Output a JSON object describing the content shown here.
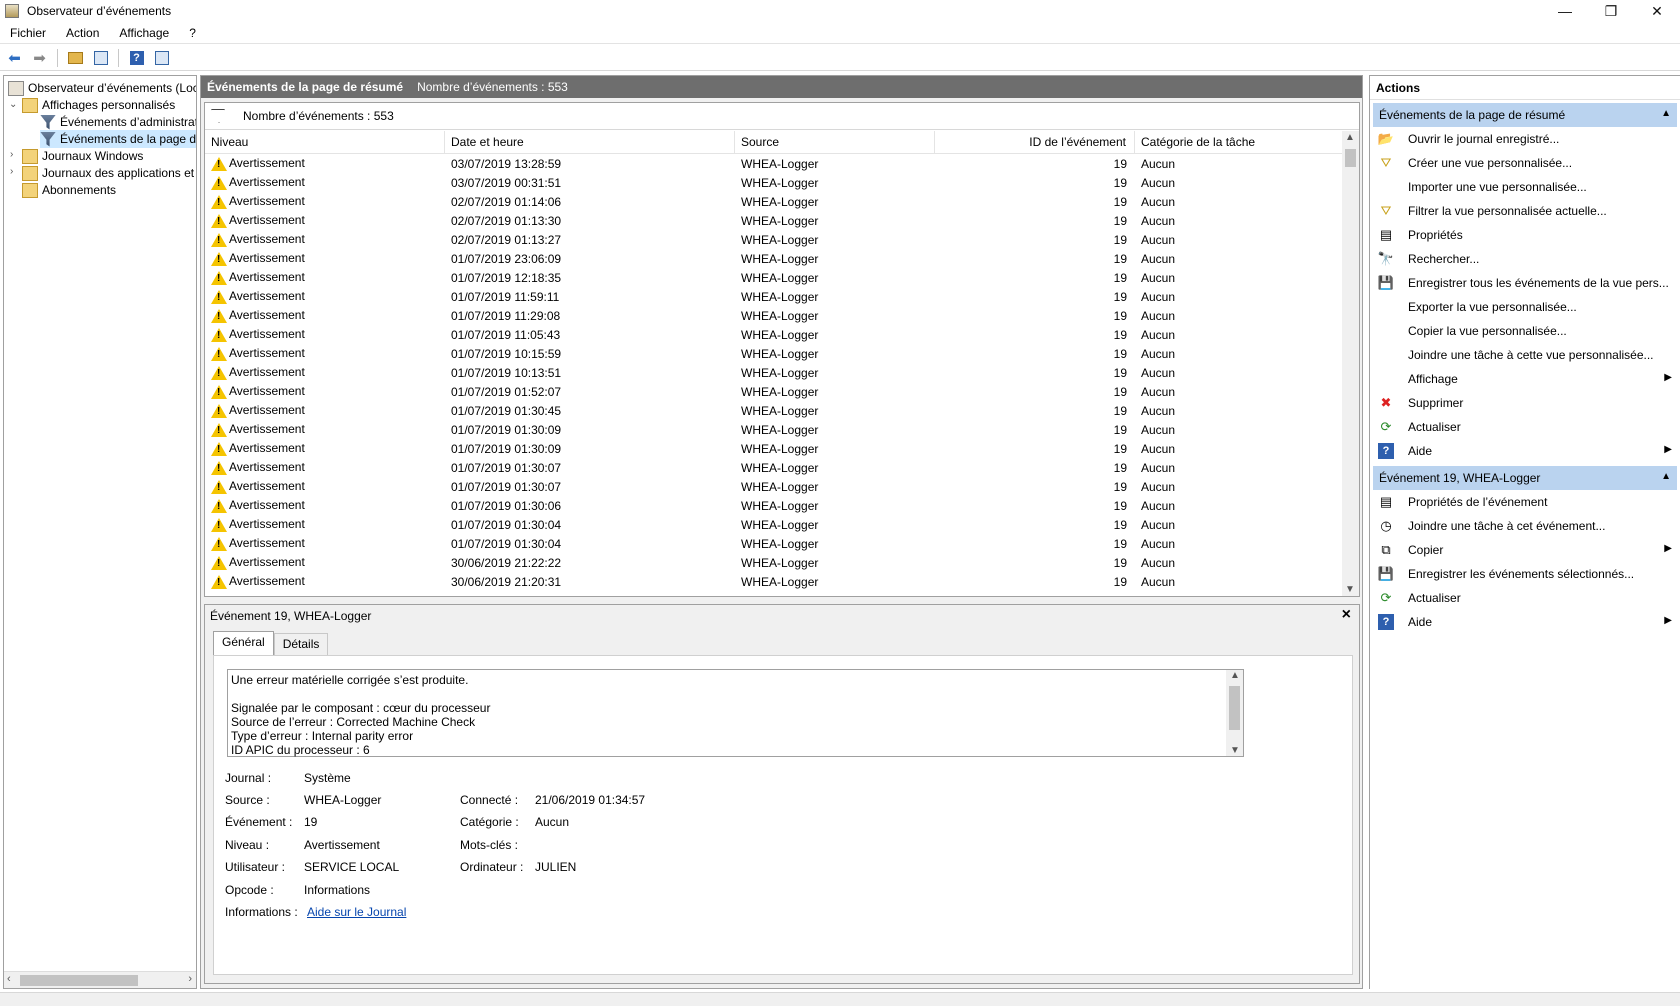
{
  "window": {
    "title": "Observateur d’événements",
    "min": "—",
    "max": "❐",
    "close": "✕"
  },
  "menu": [
    "Fichier",
    "Action",
    "Affichage",
    "?"
  ],
  "tree": {
    "root": "Observateur d’événements (Local)",
    "custom_views": "Affichages personnalisés",
    "admin_events": "Événements d’administration",
    "summary_events": "Événements de la page de résumé",
    "windows_logs": "Journaux Windows",
    "app_logs": "Journaux des applications et services",
    "subscriptions": "Abonnements"
  },
  "center": {
    "title": "Événements de la page de résumé",
    "count": "Nombre d’événements : 553",
    "filter_text": "Nombre d’événements : 553",
    "columns": [
      "Niveau",
      "Date et heure",
      "Source",
      "ID de l’événement",
      "Catégorie de la tâche"
    ],
    "rows": [
      [
        "Avertissement",
        "03/07/2019 13:28:59",
        "WHEA-Logger",
        "19",
        "Aucun"
      ],
      [
        "Avertissement",
        "03/07/2019 00:31:51",
        "WHEA-Logger",
        "19",
        "Aucun"
      ],
      [
        "Avertissement",
        "02/07/2019 01:14:06",
        "WHEA-Logger",
        "19",
        "Aucun"
      ],
      [
        "Avertissement",
        "02/07/2019 01:13:30",
        "WHEA-Logger",
        "19",
        "Aucun"
      ],
      [
        "Avertissement",
        "02/07/2019 01:13:27",
        "WHEA-Logger",
        "19",
        "Aucun"
      ],
      [
        "Avertissement",
        "01/07/2019 23:06:09",
        "WHEA-Logger",
        "19",
        "Aucun"
      ],
      [
        "Avertissement",
        "01/07/2019 12:18:35",
        "WHEA-Logger",
        "19",
        "Aucun"
      ],
      [
        "Avertissement",
        "01/07/2019 11:59:11",
        "WHEA-Logger",
        "19",
        "Aucun"
      ],
      [
        "Avertissement",
        "01/07/2019 11:29:08",
        "WHEA-Logger",
        "19",
        "Aucun"
      ],
      [
        "Avertissement",
        "01/07/2019 11:05:43",
        "WHEA-Logger",
        "19",
        "Aucun"
      ],
      [
        "Avertissement",
        "01/07/2019 10:15:59",
        "WHEA-Logger",
        "19",
        "Aucun"
      ],
      [
        "Avertissement",
        "01/07/2019 10:13:51",
        "WHEA-Logger",
        "19",
        "Aucun"
      ],
      [
        "Avertissement",
        "01/07/2019 01:52:07",
        "WHEA-Logger",
        "19",
        "Aucun"
      ],
      [
        "Avertissement",
        "01/07/2019 01:30:45",
        "WHEA-Logger",
        "19",
        "Aucun"
      ],
      [
        "Avertissement",
        "01/07/2019 01:30:09",
        "WHEA-Logger",
        "19",
        "Aucun"
      ],
      [
        "Avertissement",
        "01/07/2019 01:30:09",
        "WHEA-Logger",
        "19",
        "Aucun"
      ],
      [
        "Avertissement",
        "01/07/2019 01:30:07",
        "WHEA-Logger",
        "19",
        "Aucun"
      ],
      [
        "Avertissement",
        "01/07/2019 01:30:07",
        "WHEA-Logger",
        "19",
        "Aucun"
      ],
      [
        "Avertissement",
        "01/07/2019 01:30:06",
        "WHEA-Logger",
        "19",
        "Aucun"
      ],
      [
        "Avertissement",
        "01/07/2019 01:30:04",
        "WHEA-Logger",
        "19",
        "Aucun"
      ],
      [
        "Avertissement",
        "01/07/2019 01:30:04",
        "WHEA-Logger",
        "19",
        "Aucun"
      ],
      [
        "Avertissement",
        "30/06/2019 21:22:22",
        "WHEA-Logger",
        "19",
        "Aucun"
      ],
      [
        "Avertissement",
        "30/06/2019 21:20:31",
        "WHEA-Logger",
        "19",
        "Aucun"
      ]
    ]
  },
  "detail": {
    "title": "Événement 19, WHEA-Logger",
    "tab_general": "Général",
    "tab_details": "Détails",
    "message": [
      "Une erreur matérielle corrigée s’est produite.",
      "Signalée par le composant : cœur du processeur",
      "Source de l’erreur : Corrected Machine Check",
      "Type d’erreur : Internal parity error",
      "ID APIC du processeur : 6"
    ],
    "labels": {
      "journal": "Journal :",
      "source": "Source :",
      "event": "Événement :",
      "level": "Niveau :",
      "user": "Utilisateur :",
      "opcode": "Opcode :",
      "info": "Informations :",
      "connected": "Connecté :",
      "category": "Catégorie :",
      "keywords": "Mots-clés :",
      "computer": "Ordinateur :"
    },
    "values": {
      "journal": "Système",
      "source": "WHEA-Logger",
      "event": "19",
      "level": "Avertissement",
      "user": "SERVICE LOCAL",
      "opcode": "Informations",
      "info_link": "Aide sur le Journal",
      "connected": "21/06/2019 01:34:57",
      "category": "Aucun",
      "keywords": "",
      "computer": "JULIEN"
    }
  },
  "actions": {
    "title": "Actions",
    "section1": "Événements de la page de résumé",
    "items1": [
      "Ouvrir le journal enregistré...",
      "Créer une vue personnalisée...",
      "Importer une vue personnalisée...",
      "Filtrer la vue personnalisée actuelle...",
      "Propriétés",
      "Rechercher...",
      "Enregistrer tous les événements de la vue pers...",
      "Exporter la vue personnalisée...",
      "Copier la vue personnalisée...",
      "Joindre une tâche à cette vue personnalisée...",
      "Affichage",
      "Supprimer",
      "Actualiser",
      "Aide"
    ],
    "section2": "Événement 19, WHEA-Logger",
    "items2": [
      "Propriétés de l’événement",
      "Joindre une tâche à cet événement...",
      "Copier",
      "Enregistrer les événements sélectionnés...",
      "Actualiser",
      "Aide"
    ]
  }
}
